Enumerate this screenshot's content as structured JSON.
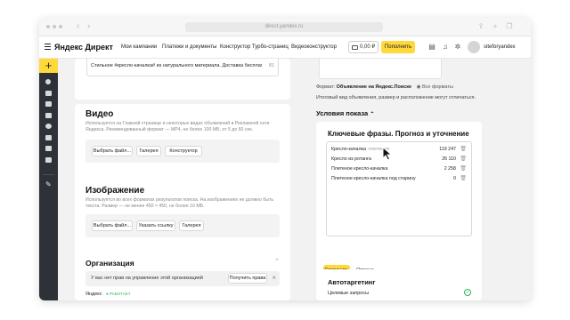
{
  "browser": {
    "url": "direct.yandex.ru"
  },
  "header": {
    "logo": "Яндекс Директ",
    "nav": [
      "Мои кампании",
      "Платежи и документы",
      "Конструктор Турбо-страниц",
      "Видеоконструктор"
    ],
    "balance": "0,00 ₽",
    "topup_label": "Пополнить",
    "username": "siteforyandex"
  },
  "left": {
    "ad_text": "Стильное #кресло-качалка# из натурального материала. Доставка бесплатно!",
    "ad_text_counter": "81",
    "video": {
      "title": "Видео",
      "desc": "Используется на Главной странице и некоторых видах объявлений в Рекламной сети Яндекса. Рекомендованный формат — MP4, не более 100 МБ, от 5 до 60 сек.",
      "buttons": [
        "Выбрать файл...",
        "Галерея",
        "Конструктор"
      ]
    },
    "image": {
      "title": "Изображение",
      "desc": "Используется во всех форматах результатов поиска. На изображениях не должно быть текста. Размер — не менее 450 × 450, не более 10 МБ.",
      "buttons": [
        "Выбрать файл...",
        "Указать ссылку",
        "Галерея"
      ]
    },
    "organization": {
      "title": "Организация",
      "notice": "У вас нет прав на управление этой организацией",
      "request_label": "Получить права",
      "partial": "Яндекс",
      "badge": "РАБОТАЕТ"
    }
  },
  "right": {
    "format_label": "Формат:",
    "format_value": "Объявление на Яндекс.Поиске",
    "all_formats": "Все форматы",
    "preview_note": "Итоговый вид объявления, размер и расположение могут отличаться.",
    "conditions_title": "Условия показа",
    "keywords": {
      "title": "Ключевые фразы. Прогноз и уточнение",
      "rows": [
        {
          "phrase": "Кресло-качалка",
          "suffix": "-плетеная",
          "count": "119 247"
        },
        {
          "phrase": "Кресло из ротанга",
          "suffix": "",
          "count": "26 110"
        },
        {
          "phrase": "Плетеное кресло-качалка",
          "suffix": "",
          "count": "2 258"
        },
        {
          "phrase": "Плетеное кресло-качалка под старину",
          "suffix": "",
          "count": "0"
        }
      ],
      "save_label": "Сохранить",
      "cancel_label": "Отмена"
    },
    "autotargeting": {
      "title": "Автотаргетинг",
      "item": "Целевые запросы"
    }
  },
  "colors": {
    "accent": "#ffd83a",
    "sidebar": "#2e3138",
    "success": "#2fb45a"
  }
}
